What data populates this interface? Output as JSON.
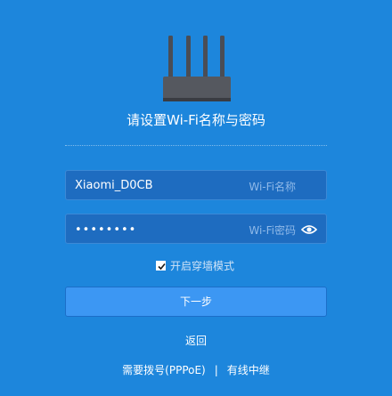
{
  "header": {
    "title": "请设置Wi-Fi名称与密码",
    "icon": "router-icon"
  },
  "form": {
    "ssid": {
      "value": "Xiaomi_D0CB",
      "hint": "Wi-Fi名称"
    },
    "password": {
      "value": "••••••••",
      "hint": "Wi-Fi密码",
      "icon": "eye-icon"
    },
    "wall_mode": {
      "label": "开启穿墙模式",
      "checked": true
    },
    "next_label": "下一步"
  },
  "nav": {
    "back_label": "返回",
    "pppoe_label": "需要拨号(PPPoE)",
    "separator": "|",
    "repeater_label": "有线中继"
  },
  "colors": {
    "background": "#1d86dc",
    "field": "#1e6cc0",
    "button": "#3c97f3"
  }
}
